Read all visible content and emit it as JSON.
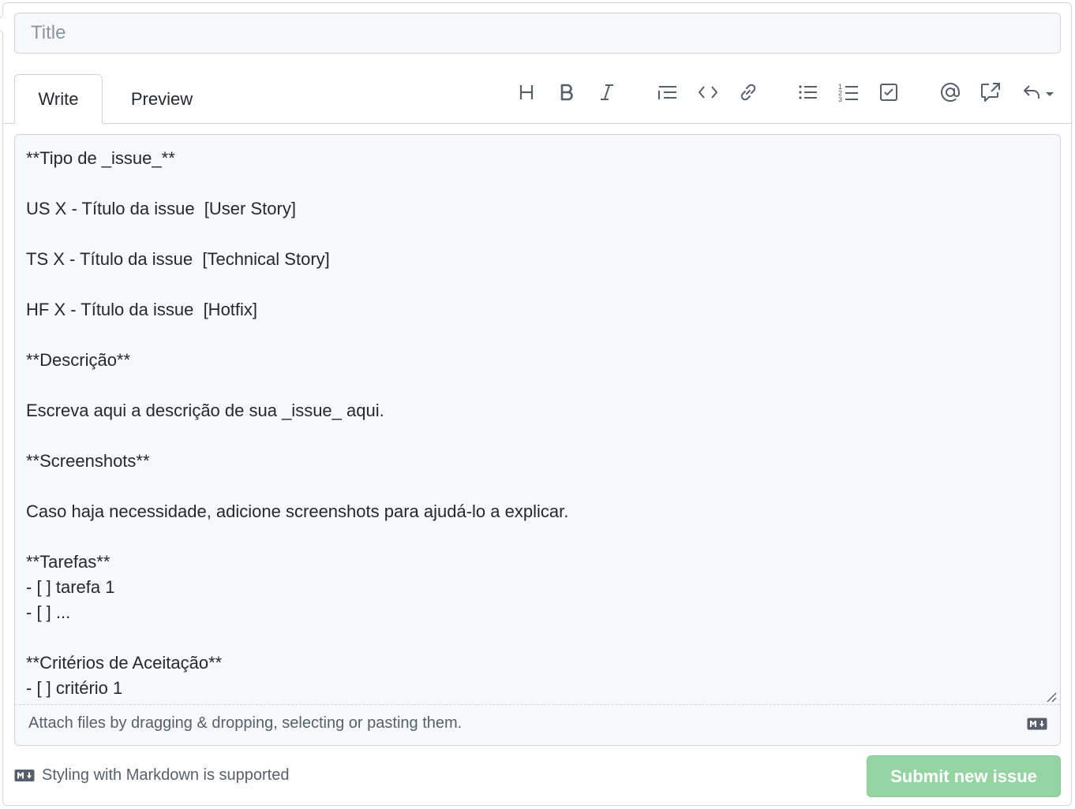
{
  "title_field": {
    "placeholder": "Title",
    "value": ""
  },
  "tabs": {
    "write": "Write",
    "preview": "Preview"
  },
  "toolbar": {
    "icons": [
      "heading-icon",
      "bold-icon",
      "italic-icon",
      "quote-icon",
      "code-icon",
      "link-icon",
      "bullet-list-icon",
      "numbered-list-icon",
      "task-list-icon",
      "mention-icon",
      "reference-icon",
      "reply-icon"
    ]
  },
  "editor": {
    "body": "**Tipo de _issue_**\n\nUS X - Título da issue  [User Story]\n\nTS X - Título da issue  [Technical Story]\n\nHF X - Título da issue  [Hotfix]\n\n**Descrição**\n\nEscreva aqui a descrição de sua _issue_ aqui.\n\n**Screenshots**\n\nCaso haja necessidade, adicione screenshots para ajudá-lo a explicar.\n\n**Tarefas**\n- [ ] tarefa 1\n- [ ] ...\n\n**Critérios de Aceitação**\n- [ ] critério 1",
    "attach_text": "Attach files by dragging & dropping, selecting or pasting them."
  },
  "footer": {
    "markdown_note": "Styling with Markdown is supported",
    "submit_label": "Submit new issue"
  },
  "colors": {
    "border": "#d1d5da",
    "input_bg": "#f6f8fa",
    "icon": "#57606a",
    "submit_disabled": "#94d3a2"
  }
}
